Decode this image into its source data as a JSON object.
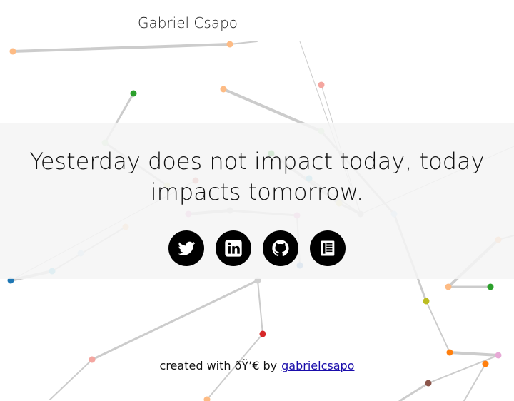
{
  "header": {
    "name": "Gabriel Csapo"
  },
  "hero": {
    "quote": "Yesterday does not impact today, today impacts tomorrow."
  },
  "socials": [
    {
      "icon": "twitter-icon"
    },
    {
      "icon": "linkedin-icon"
    },
    {
      "icon": "github-icon"
    },
    {
      "icon": "blog-icon"
    }
  ],
  "footer": {
    "prefix": "created with ðŸ’€ by",
    "link_label": "gabrielcsapo"
  },
  "colors": {
    "background": "#ffffff",
    "hero_band": "#f4f4f4",
    "icon_bg": "#000000",
    "link": "#1a0dab"
  }
}
